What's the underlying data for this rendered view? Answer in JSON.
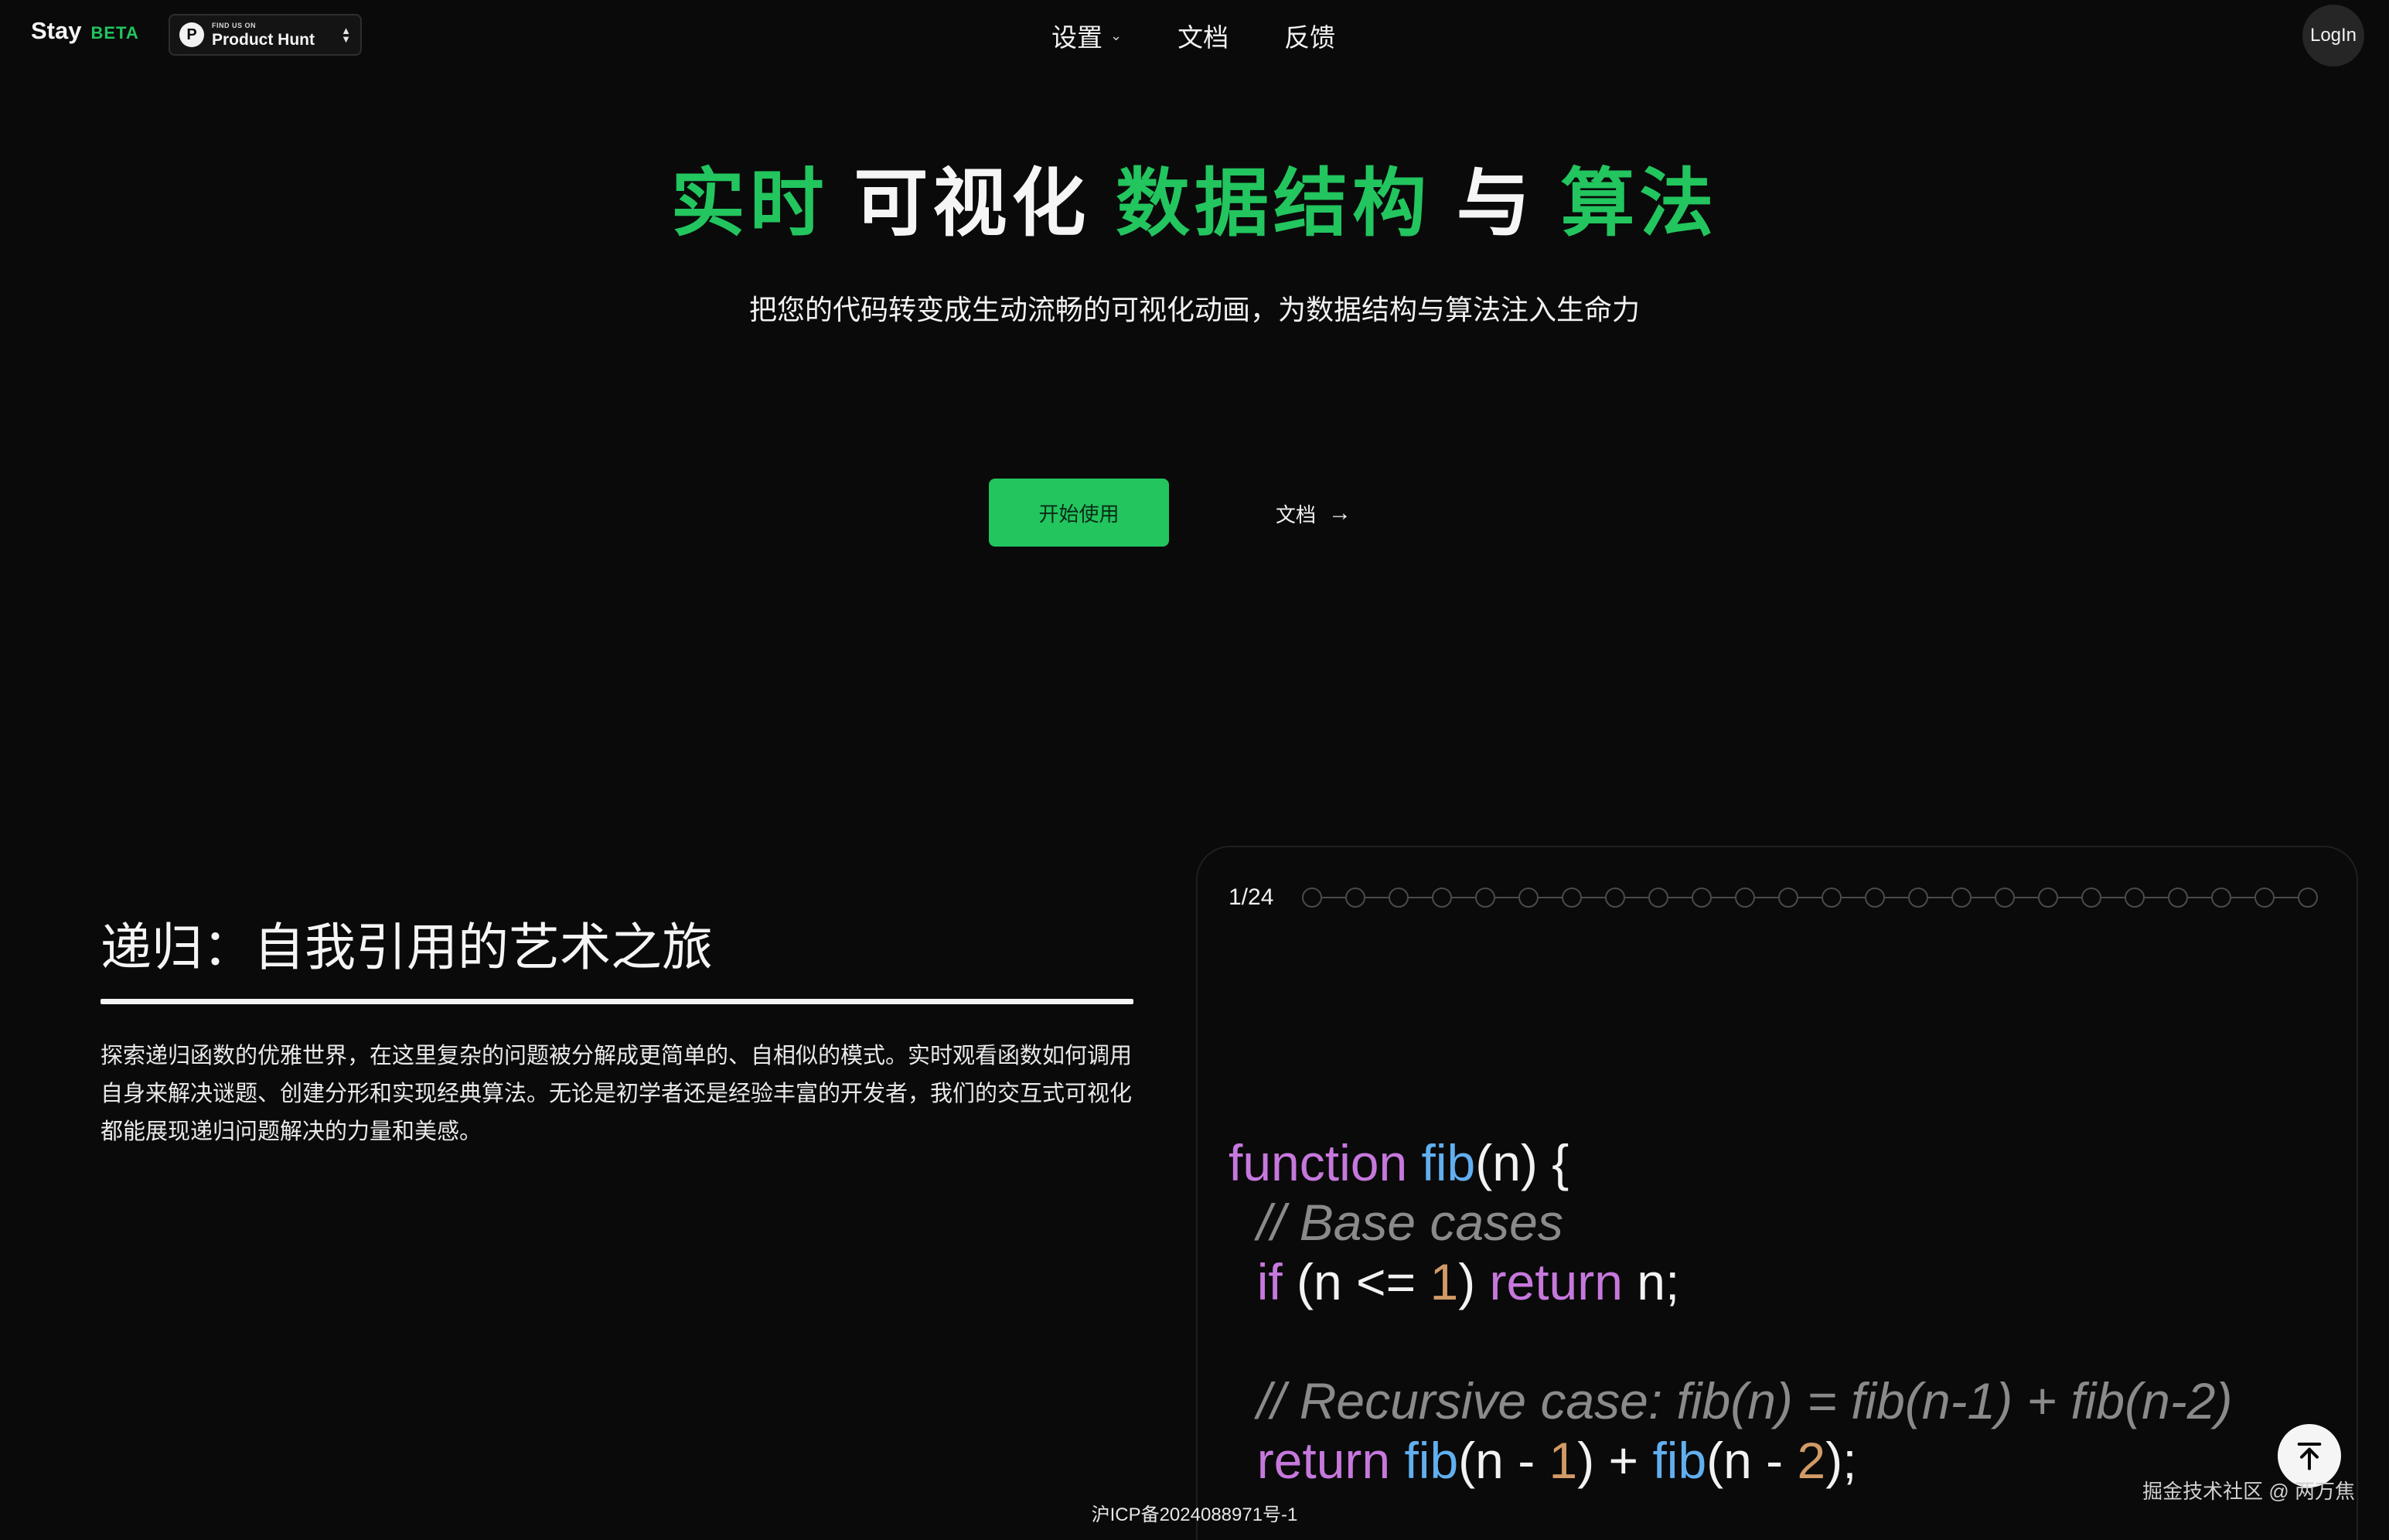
{
  "header": {
    "brand": "Stay",
    "beta": "BETA",
    "product_hunt": {
      "small": "FIND US ON",
      "big": "Product Hunt",
      "logo": "P"
    },
    "nav": [
      {
        "label": "设置",
        "icon": "chevron-down-icon"
      },
      {
        "label": "文档"
      },
      {
        "label": "反馈"
      }
    ],
    "login": "LogIn"
  },
  "hero": {
    "title": {
      "p1": "实时",
      "p2": "可视化",
      "p3": "数据结构",
      "p4": "与",
      "p5": "算法"
    },
    "subtitle": "把您的代码转变成生动流畅的可视化动画，为数据结构与算法注入生命力",
    "start_button": "开始使用",
    "docs_link": "文档"
  },
  "recursion": {
    "title": "递归：自我引用的艺术之旅",
    "description": "探索递归函数的优雅世界，在这里复杂的问题被分解成更简单的、自相似的模式。实时观看函数如何调用自身来解决谜题、创建分形和实现经典算法。无论是初学者还是经验丰富的开发者，我们的交互式可视化都能展现递归问题解决的力量和美感。"
  },
  "visualizer": {
    "step_label": "1/24",
    "total_steps": 24,
    "code": {
      "l1": {
        "kw": "function",
        "fn": "fib",
        "rest": "(n) {"
      },
      "l2": {
        "comment": "// Base cases"
      },
      "l3": {
        "kw": "if",
        "a": " (n <= ",
        "num": "1",
        "b": ") ",
        "kw2": "return",
        "c": " n;"
      },
      "l5": {
        "comment": "// Recursive case: fib(n) = fib(n-1) + fib(n-2)"
      },
      "l6": {
        "kw": "return",
        "fn1": "fib",
        "a": "(n - ",
        "num1": "1",
        "b": ") + ",
        "fn2": "fib",
        "c": "(n - ",
        "num2": "2",
        "d": ");"
      }
    }
  },
  "footer": {
    "icp": "沪ICP备2024088971号-1",
    "watermark": "掘金技术社区 @ 两万焦"
  },
  "colors": {
    "accent": "#22c55e",
    "keyword": "#c678dd",
    "function": "#61afef",
    "number": "#d19a66",
    "comment": "#8a8a8a"
  }
}
